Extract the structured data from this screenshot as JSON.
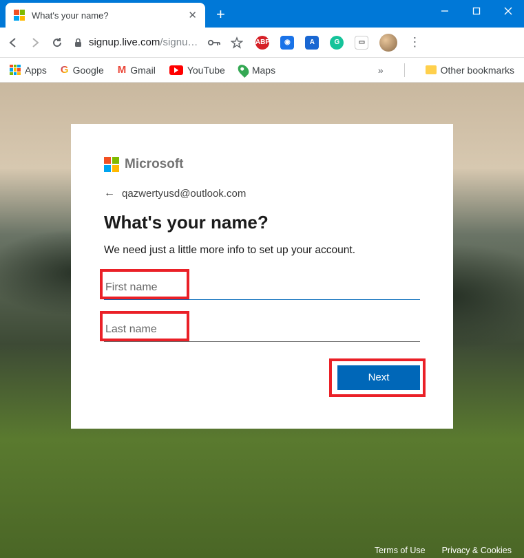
{
  "browser": {
    "tab_title": "What's your name?",
    "url_display_host": "signup.live.com",
    "url_display_path": "/signu…",
    "bookmarks": {
      "apps": "Apps",
      "google": "Google",
      "gmail": "Gmail",
      "youtube": "YouTube",
      "maps": "Maps",
      "other": "Other bookmarks",
      "more": "»"
    }
  },
  "signup": {
    "brand": "Microsoft",
    "email": "qazwertyusd@outlook.com",
    "heading": "What's your name?",
    "subtext": "We need just a little more info to set up your account.",
    "first_name_placeholder": "First name",
    "last_name_placeholder": "Last name",
    "next_label": "Next"
  },
  "footer": {
    "terms": "Terms of Use",
    "privacy": "Privacy & Cookies"
  }
}
